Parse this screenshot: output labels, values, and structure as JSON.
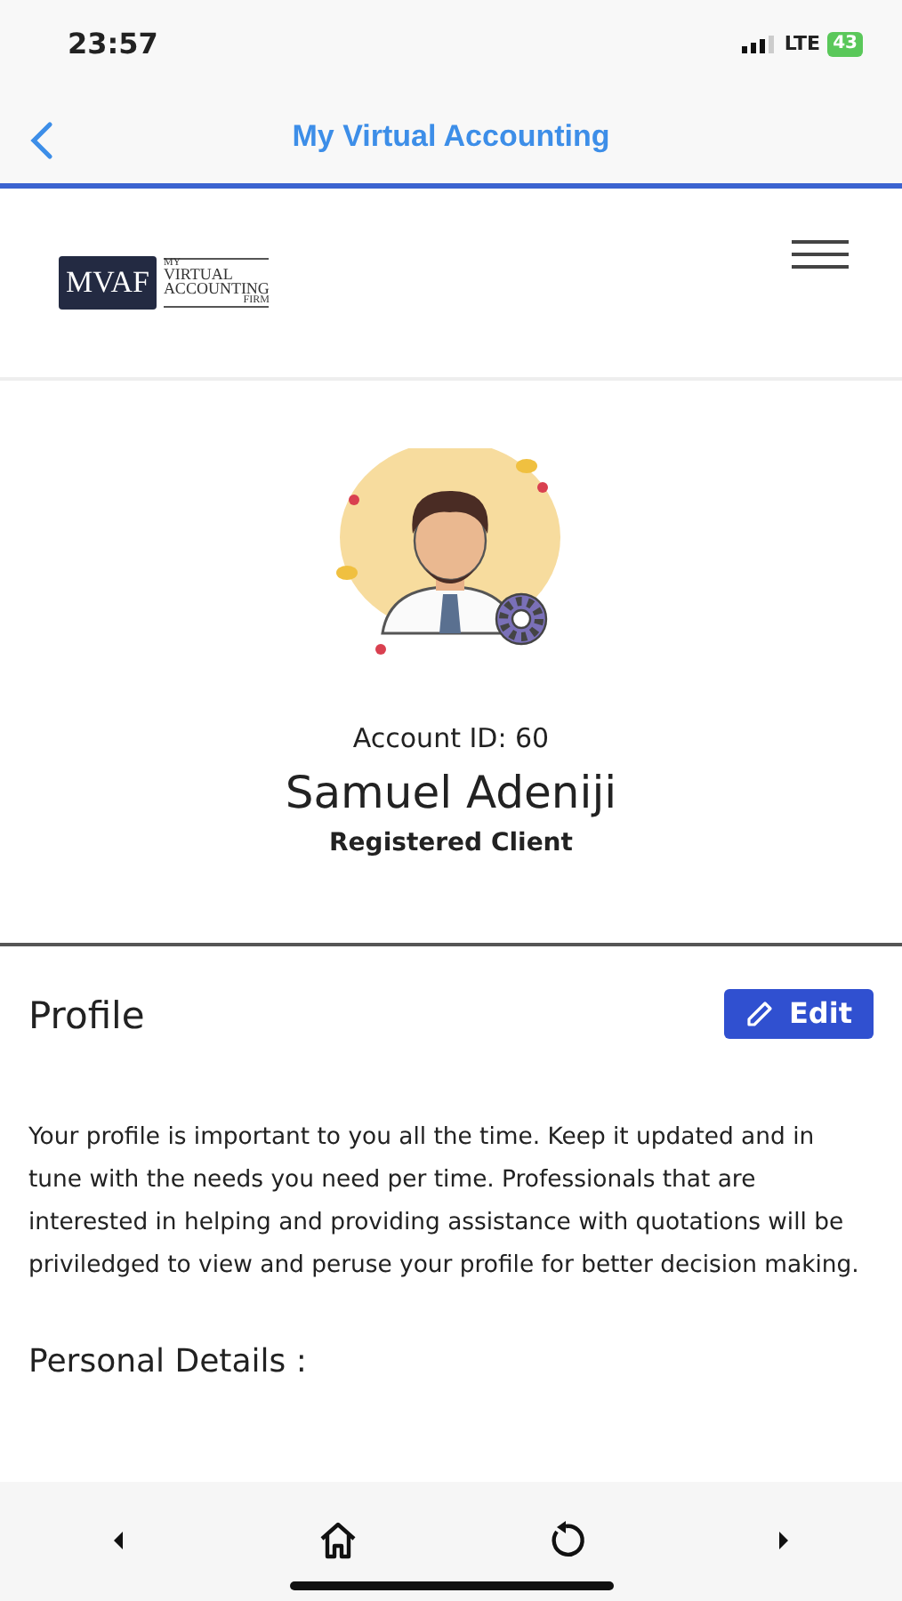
{
  "status_bar": {
    "time": "23:57",
    "network": "LTE",
    "battery": "43"
  },
  "nav_bar": {
    "title": "My Virtual Accounting"
  },
  "logo": {
    "mark": "MVAF",
    "lines": [
      "MY",
      "VIRTUAL",
      "ACCOUNTING",
      "FIRM"
    ]
  },
  "account": {
    "id_label": "Account ID: 60",
    "name": "Samuel Adeniji",
    "role": "Registered Client"
  },
  "profile": {
    "title": "Profile",
    "edit_button": "Edit",
    "description": "Your profile is important to you all the time. Keep it updated and in tune with the needs you need per time. Professionals that are interested in helping and providing assistance with quotations will be priviledged to view and peruse your profile for better decision making.",
    "section_title": "Personal Details :"
  }
}
